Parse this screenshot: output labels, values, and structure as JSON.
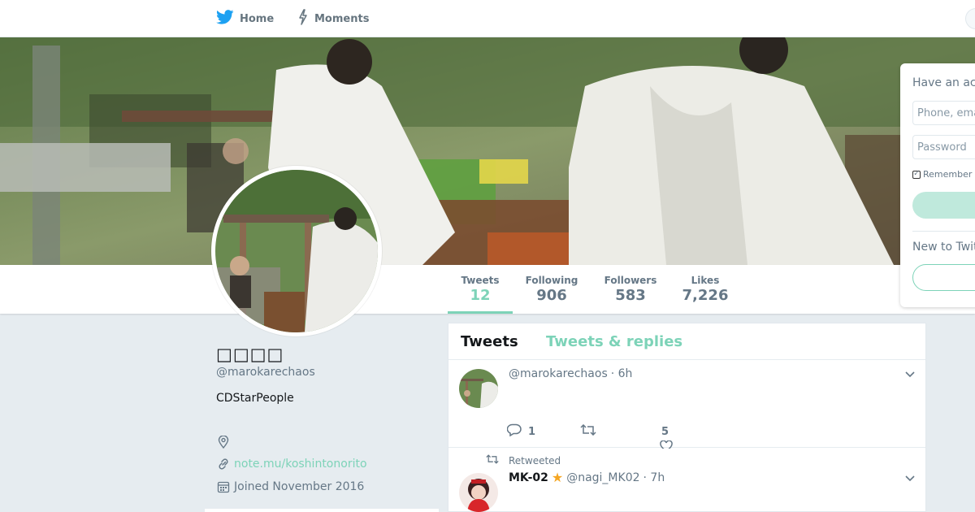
{
  "nav": {
    "home_label": "Home",
    "moments_label": "Moments"
  },
  "profile": {
    "name": "□□□□",
    "handle": "@marokarechaos",
    "bio": "CDStarPeople",
    "location": "",
    "url": "note.mu/koshintonorito",
    "joined": "Joined November 2016"
  },
  "stats": [
    {
      "label": "Tweets",
      "value": "12",
      "active": true
    },
    {
      "label": "Following",
      "value": "906",
      "active": false
    },
    {
      "label": "Followers",
      "value": "583",
      "active": false
    },
    {
      "label": "Likes",
      "value": "7,226",
      "active": false
    }
  ],
  "login": {
    "title": "Have an account?",
    "phone_placeholder": "Phone, email or username",
    "password_placeholder": "Password",
    "remember_label": "Remember me",
    "new_to": "New to Twitter?"
  },
  "timeline": {
    "tabs": [
      "Tweets",
      "Tweets & replies"
    ],
    "tweets": [
      {
        "handle": "@marokarechaos",
        "time": "· 6h",
        "reply_count": "1",
        "like_count": "5"
      },
      {
        "retweeted_label": "Retweeted",
        "name": "MK-02",
        "badge": "★",
        "handle": "@nagi_MK02",
        "time": "· 7h"
      }
    ]
  },
  "colors": {
    "accent": "#7dd3b8",
    "twitter_blue": "#1da1f2",
    "background": "#e6ecf0",
    "muted": "#657786"
  }
}
